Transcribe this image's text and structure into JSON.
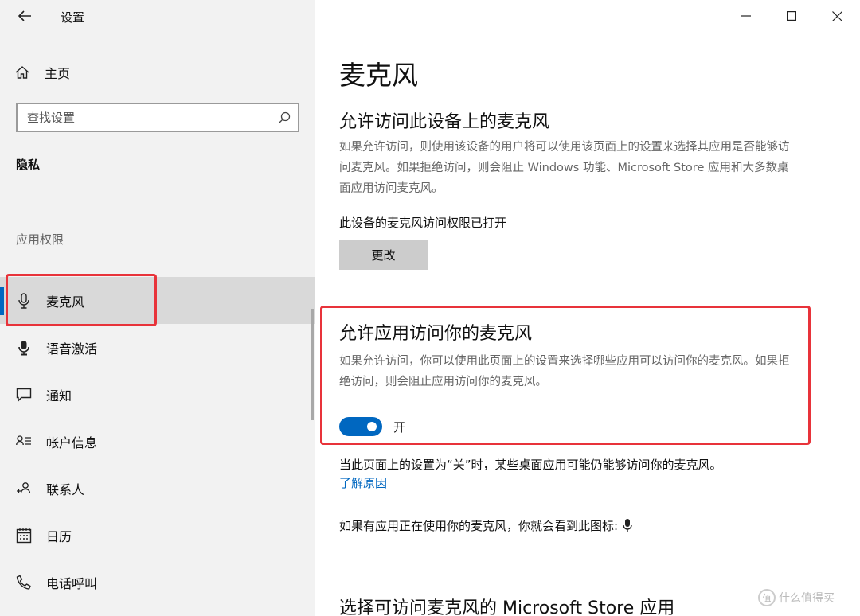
{
  "window": {
    "title": "设置"
  },
  "sidebar": {
    "home_label": "主页",
    "search_placeholder": "查找设置",
    "section_heading": "隐私",
    "group_label": "应用权限",
    "items": [
      {
        "label": "麦克风",
        "icon": "microphone-icon",
        "selected": true
      },
      {
        "label": "语音激活",
        "icon": "voice-activation-icon",
        "selected": false
      },
      {
        "label": "通知",
        "icon": "notification-icon",
        "selected": false
      },
      {
        "label": "帐户信息",
        "icon": "account-info-icon",
        "selected": false
      },
      {
        "label": "联系人",
        "icon": "contacts-icon",
        "selected": false
      },
      {
        "label": "日历",
        "icon": "calendar-icon",
        "selected": false
      },
      {
        "label": "电话呼叫",
        "icon": "phone-icon",
        "selected": false
      }
    ]
  },
  "main": {
    "page_title": "麦克风",
    "device_section": {
      "heading": "允许访问此设备上的麦克风",
      "description": "如果允许访问，则使用该设备的用户将可以使用该页面上的设置来选择其应用是否能够访问麦克风。如果拒绝访问，则会阻止 Windows 功能、Microsoft Store 应用和大多数桌面应用访问麦克风。",
      "status": "此设备的麦克风访问权限已打开",
      "change_button": "更改"
    },
    "app_section": {
      "heading": "允许应用访问你的麦克风",
      "description": "如果允许访问，你可以使用此页面上的设置来选择哪些应用可以访问你的麦克风。如果拒绝访问，则会阻止应用访问你的麦克风。",
      "toggle_on": true,
      "toggle_label": "开"
    },
    "note": "当此页面上的设置为“关”时，某些桌面应用可能仍能够访问你的麦克风。",
    "learn_more_link": "了解原因",
    "icon_note": "如果有应用正在使用你的麦克风，你就会看到此图标:",
    "store_section_heading": "选择可访问麦克风的 Microsoft Store 应用"
  },
  "watermark": {
    "text": "什么值得买",
    "badge": "值"
  },
  "colors": {
    "accent": "#0067c0",
    "sidebar_bg": "#f2f2f2",
    "selected_bg": "#d9d9d9",
    "highlight_red": "#e8333a",
    "secondary_text": "#666666"
  }
}
